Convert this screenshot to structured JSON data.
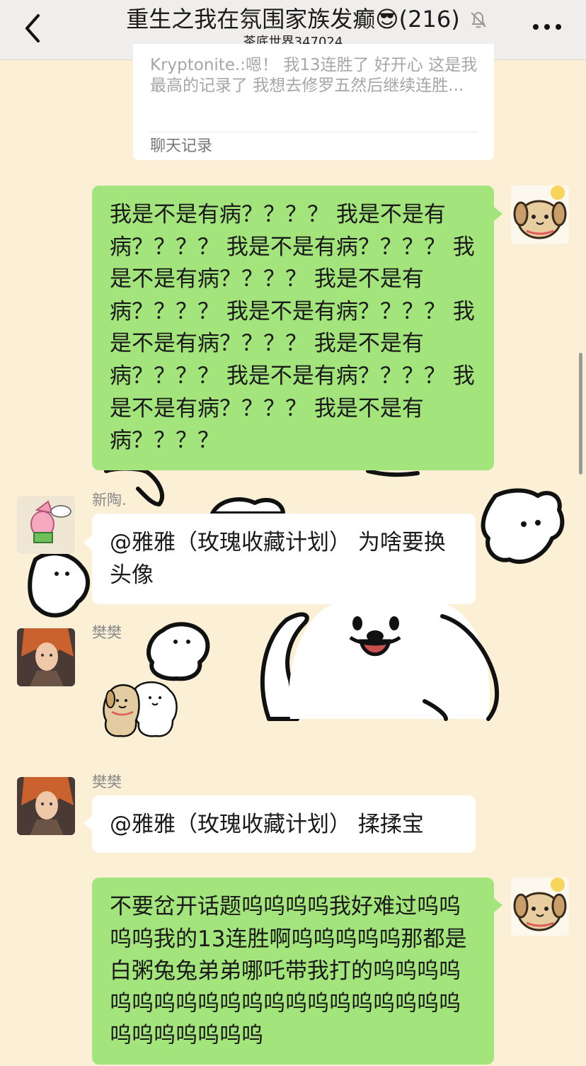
{
  "header": {
    "title": "重生之我在氛围家族发癫😎(216)",
    "subtitle": "茶底世界347024"
  },
  "quote_card": {
    "text": "Kryptonite.:嗯！ 我13连胜了 好开心  这是我最高的记录了  我想去修罗五然后继续连胜...",
    "label": "聊天记录"
  },
  "messages": [
    {
      "side": "right",
      "text": "我是不是有病？？？？ 我是不是有病？？？？ 我是不是有病？？？？ 我是不是有病？？？？ 我是不是有病？？？？ 我是不是有病？？？？ 我是不是有病？？？？ 我是不是有病？？？？ 我是不是有病？？？？ 我是不是有病？？？？ 我是不是有病？？？？"
    },
    {
      "side": "left",
      "sender": "新陶.",
      "text": "@雅雅（玫瑰收藏计划） 为啥要换头像"
    },
    {
      "side": "left",
      "sender": "樊樊",
      "type": "sticker"
    },
    {
      "side": "left",
      "sender": "樊樊",
      "text": "@雅雅（玫瑰收藏计划） 揉揉宝"
    },
    {
      "side": "right",
      "text": "不要岔开话题呜呜呜呜我好难过呜呜呜呜我的13连胜啊呜呜呜呜呜那都是白粥兔兔弟弟哪吒带我打的呜呜呜呜呜呜呜呜呜呜呜呜呜呜呜呜呜呜呜呜呜呜呜呜呜呜呜"
    }
  ],
  "colors": {
    "background": "#fbf0d6",
    "header": "#efeeec",
    "bubble_self": "#a4e47d",
    "bubble_other": "#ffffff",
    "name": "#8a8a8a"
  },
  "icons": [
    "chevron-left-icon",
    "mute-bell-icon",
    "more-icon",
    "dog-sticker"
  ]
}
